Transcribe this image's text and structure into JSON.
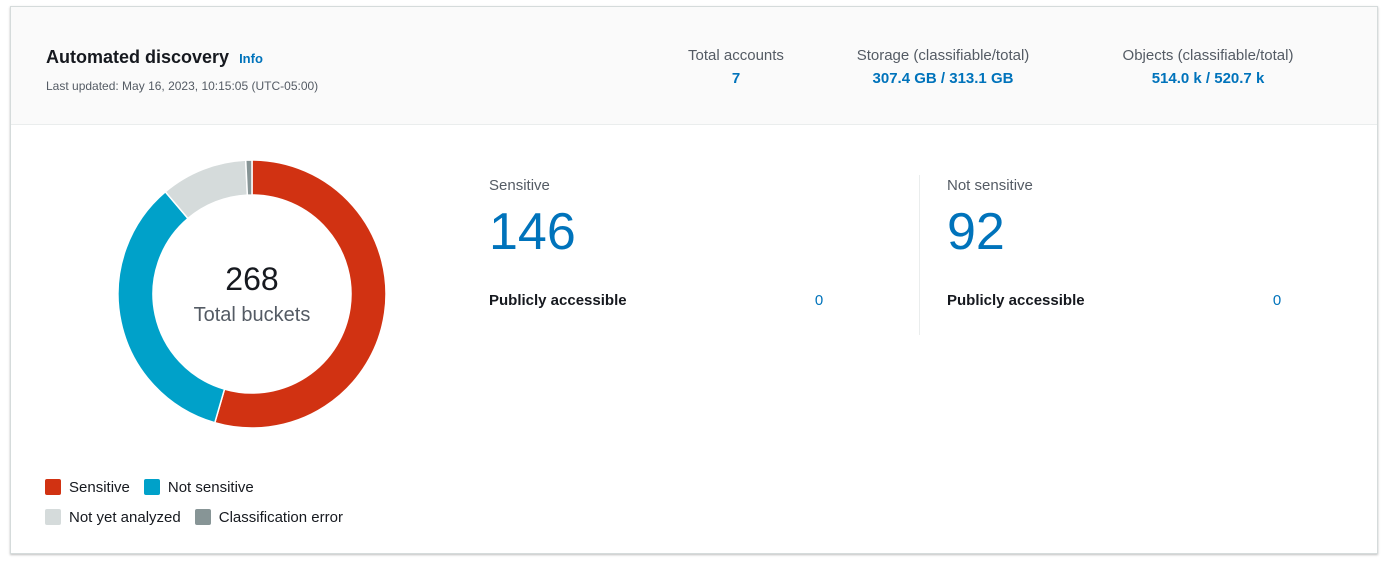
{
  "header": {
    "title": "Automated discovery",
    "info_link": "Info",
    "last_updated": "Last updated: May 16, 2023, 10:15:05 (UTC-05:00)"
  },
  "stats": {
    "accounts": {
      "label": "Total accounts",
      "value": "7"
    },
    "storage": {
      "label": "Storage (classifiable/total)",
      "value": "307.4 GB / 313.1 GB"
    },
    "objects": {
      "label": "Objects (classifiable/total)",
      "value": "514.0 k / 520.7 k"
    }
  },
  "donut": {
    "total": "268",
    "total_label": "Total buckets",
    "segments": [
      {
        "name": "Sensitive",
        "value": 146,
        "color": "#d13212"
      },
      {
        "name": "Not sensitive",
        "value": 92,
        "color": "#00a1c9"
      },
      {
        "name": "Not yet analyzed",
        "value": 28,
        "color": "#d5dbdb"
      },
      {
        "name": "Classification error",
        "value": 2,
        "color": "#879596"
      }
    ]
  },
  "legend": [
    {
      "label": "Sensitive",
      "color": "#d13212"
    },
    {
      "label": "Not sensitive",
      "color": "#00a1c9"
    },
    {
      "label": "Not yet analyzed",
      "color": "#d5dbdb"
    },
    {
      "label": "Classification error",
      "color": "#879596"
    }
  ],
  "metrics": {
    "sensitive": {
      "label": "Sensitive",
      "value": "146",
      "sub_label": "Publicly accessible",
      "sub_value": "0"
    },
    "not_sensitive": {
      "label": "Not sensitive",
      "value": "92",
      "sub_label": "Publicly accessible",
      "sub_value": "0"
    }
  }
}
